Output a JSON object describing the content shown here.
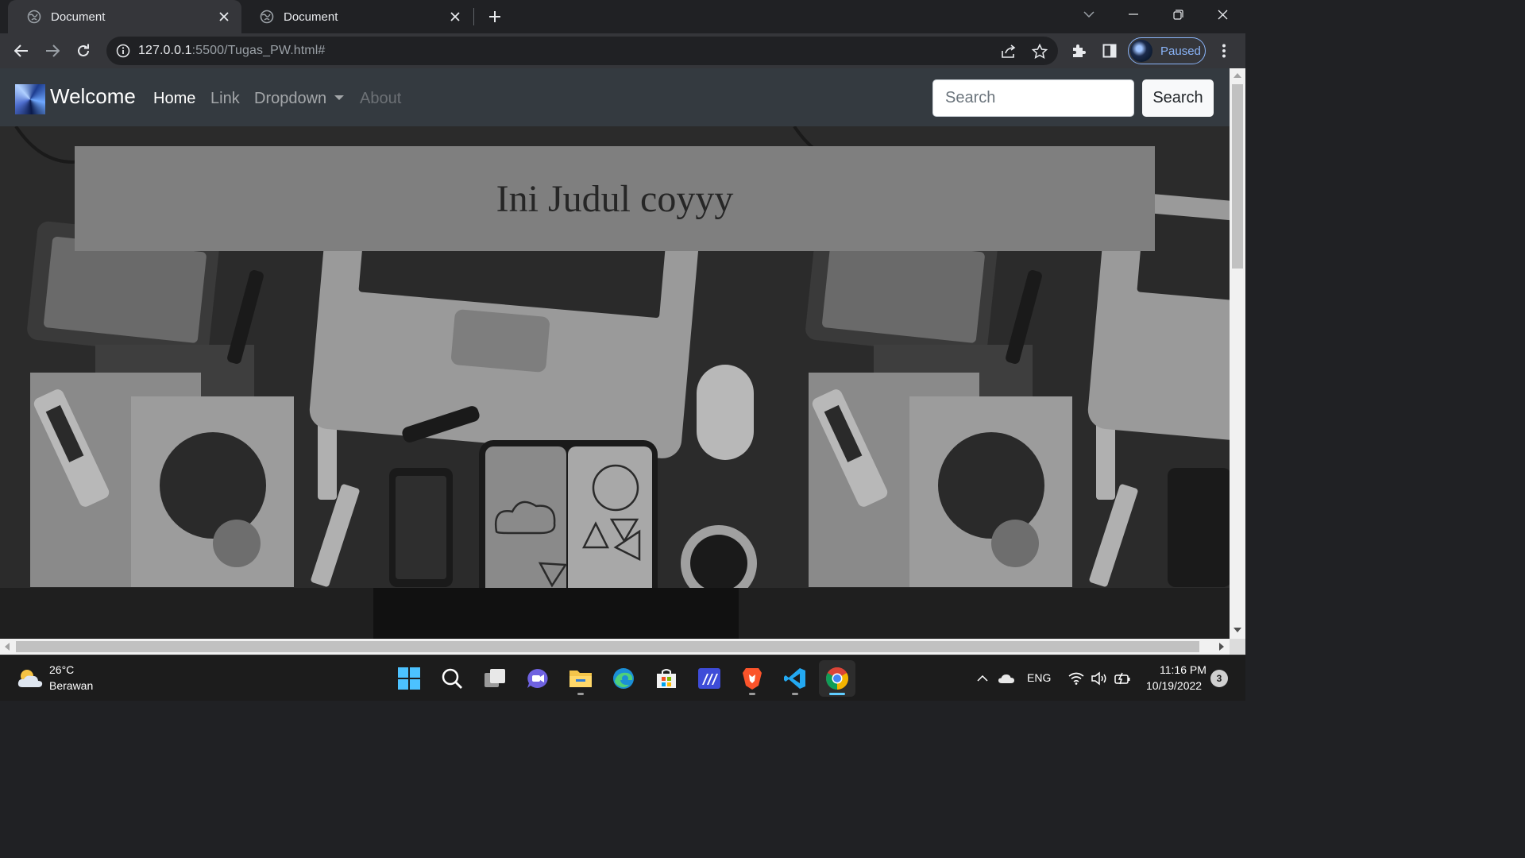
{
  "browser": {
    "tabs": [
      {
        "title": "Document",
        "active": true
      },
      {
        "title": "Document",
        "active": false
      }
    ],
    "url_host": "127.0.0.1",
    "url_rest": ":5500/Tugas_PW.html#",
    "profile_status": "Paused"
  },
  "site": {
    "brand": "Welcome",
    "nav": [
      {
        "label": "Home",
        "state": "active"
      },
      {
        "label": "Link",
        "state": "normal"
      },
      {
        "label": "Dropdown",
        "state": "dropdown"
      },
      {
        "label": "About",
        "state": "disabled"
      }
    ],
    "search_placeholder": "Search",
    "search_button": "Search",
    "hero_title": "Ini Judul coyyy"
  },
  "taskbar": {
    "temperature": "26°C",
    "condition": "Berawan",
    "language": "ENG",
    "time": "11:16 PM",
    "date": "10/19/2022",
    "notifications": "3",
    "apps": [
      "start-icon",
      "search-icon",
      "task-view-icon",
      "chat-icon",
      "file-explorer-icon",
      "edge-icon",
      "store-icon",
      "code-editor-icon",
      "brave-icon",
      "vscode-icon",
      "chrome-icon"
    ]
  },
  "colors": {
    "navbar": "#343a40",
    "jumbotron": "#7f7f7f",
    "profile_accent": "#8ab4f8"
  }
}
